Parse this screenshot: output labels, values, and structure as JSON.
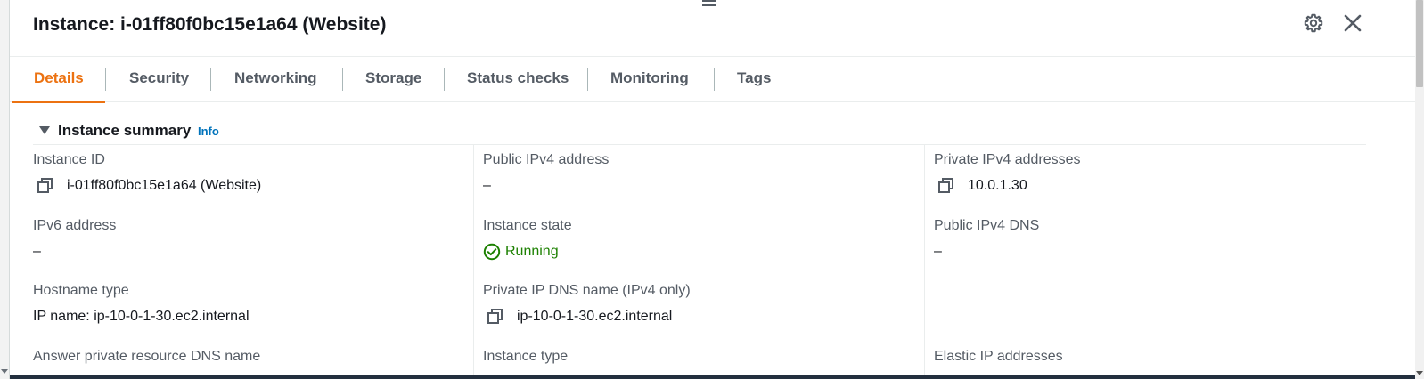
{
  "panel": {
    "title": "Instance: i-01ff80f0bc15e1a64 (Website)"
  },
  "icons": {
    "settings": "gear-icon",
    "close": "close-icon",
    "copy": "copy-icon",
    "status": "check-circle-icon",
    "expand": "caret-down-icon"
  },
  "colors": {
    "active_tab": "#ec7211",
    "link": "#0073bb",
    "running": "#1d8102"
  },
  "tabs": [
    {
      "label": "Details",
      "active": true
    },
    {
      "label": "Security",
      "active": false
    },
    {
      "label": "Networking",
      "active": false
    },
    {
      "label": "Storage",
      "active": false
    },
    {
      "label": "Status checks",
      "active": false
    },
    {
      "label": "Monitoring",
      "active": false
    },
    {
      "label": "Tags",
      "active": false
    }
  ],
  "summary": {
    "title": "Instance summary",
    "info_label": "Info"
  },
  "fields": {
    "instance_id": {
      "label": "Instance ID",
      "value": "i-01ff80f0bc15e1a64 (Website)"
    },
    "public_ipv4": {
      "label": "Public IPv4 address",
      "value": "–"
    },
    "private_ipv4": {
      "label": "Private IPv4 addresses",
      "value": "10.0.1.30"
    },
    "ipv6": {
      "label": "IPv6 address",
      "value": "–"
    },
    "instance_state": {
      "label": "Instance state",
      "value": "Running"
    },
    "public_dns": {
      "label": "Public IPv4 DNS",
      "value": "–"
    },
    "hostname_type": {
      "label": "Hostname type",
      "value": "IP name: ip-10-0-1-30.ec2.internal"
    },
    "private_dns": {
      "label": "Private IP DNS name (IPv4 only)",
      "value": "ip-10-0-1-30.ec2.internal"
    },
    "answer_dns": {
      "label": "Answer private resource DNS name"
    },
    "instance_type": {
      "label": "Instance type"
    },
    "elastic_ip": {
      "label": "Elastic IP addresses"
    }
  }
}
